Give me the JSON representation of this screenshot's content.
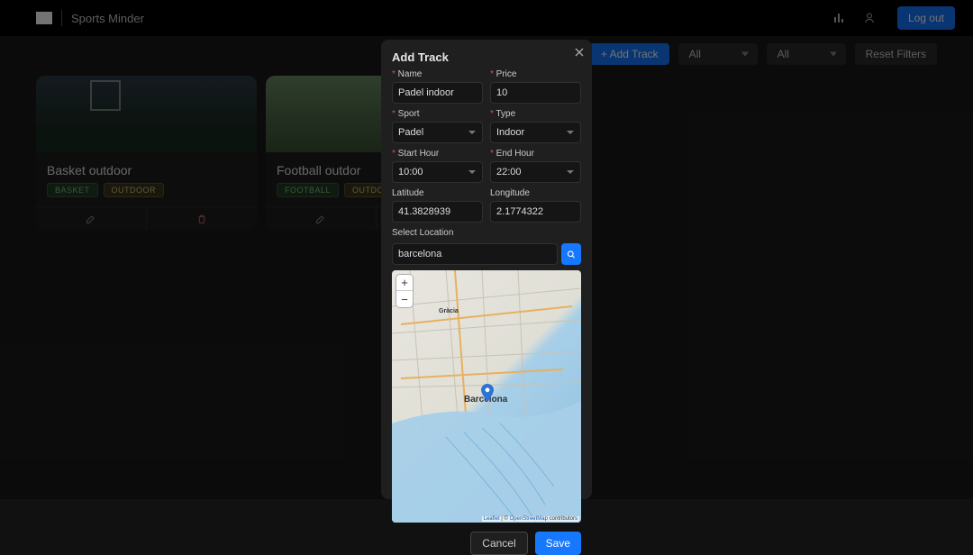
{
  "brand": {
    "name": "Sports Minder"
  },
  "topnav": {
    "logout": "Log out"
  },
  "toolbar": {
    "add_track": "+ Add Track",
    "filter1": "All",
    "filter2": "All",
    "reset": "Reset Filters"
  },
  "cards": [
    {
      "title": "Basket outdoor",
      "tags": [
        "BASKET",
        "OUTDOOR"
      ],
      "photo": "basket"
    },
    {
      "title": "Football outdor",
      "tags": [
        "FOOTBALL",
        "OUTDOOR"
      ],
      "photo": "football"
    }
  ],
  "modal": {
    "title": "Add Track",
    "labels": {
      "name": "Name",
      "price": "Price",
      "sport": "Sport",
      "type": "Type",
      "start": "Start Hour",
      "end": "End Hour",
      "lat": "Latitude",
      "lon": "Longitude",
      "select_location": "Select Location"
    },
    "values": {
      "name": "Padel indoor",
      "price": "10",
      "sport": "Padel",
      "type": "Indoor",
      "start": "10:00",
      "end": "22:00",
      "lat": "41.3828939",
      "lon": "2.1774322",
      "search": "barcelona"
    },
    "buttons": {
      "cancel": "Cancel",
      "save": "Save"
    },
    "map": {
      "zoom_in": "+",
      "zoom_out": "−",
      "labels": {
        "city": "Barcelona",
        "gracia": "Gràcia"
      },
      "attrib_leaflet": "Leaflet",
      "attrib_sep": " | © ",
      "attrib_osm": "OpenStreetMap",
      "attrib_tail": " contributors"
    }
  }
}
